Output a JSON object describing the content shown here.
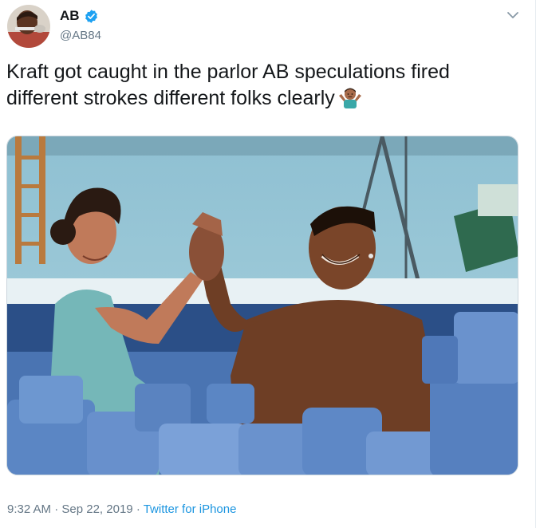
{
  "user": {
    "display_name": "AB",
    "handle": "@AB84",
    "verified": true,
    "verified_color": "#1da1f2"
  },
  "tweet": {
    "line1": "Kraft got caught in the parlor AB speculations fired",
    "line2": "different strokes different folks clearly",
    "emoji": "shrug-emoji",
    "time": "9:32 AM",
    "separator": "·",
    "date": "Sep 22, 2019",
    "source": "Twitter for iPhone"
  },
  "colors": {
    "link": "#1b95e0",
    "meta_text": "#657786",
    "foam_blue": "#5b86c4"
  }
}
